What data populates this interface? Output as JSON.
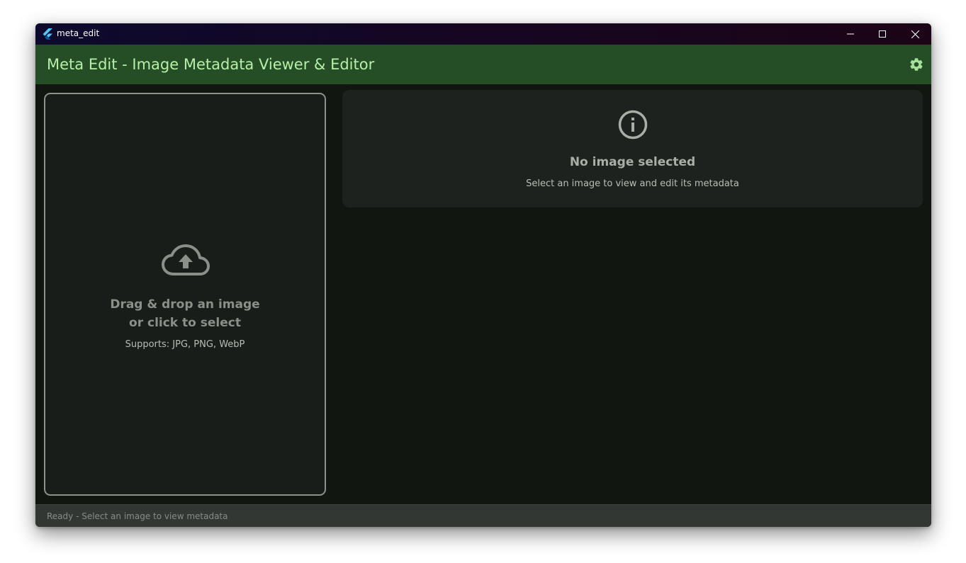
{
  "window": {
    "title": "meta_edit",
    "controls": {
      "minimize_icon": "minimize-icon",
      "maximize_icon": "maximize-icon",
      "close_icon": "close-icon"
    }
  },
  "appbar": {
    "title": "Meta Edit - Image Metadata Viewer & Editor",
    "settings_icon": "gear-icon",
    "background": "#264e26",
    "title_color": "#b6f0a8"
  },
  "dropzone": {
    "icon": "cloud-upload-icon",
    "line1": "Drag & drop an image",
    "line2": "or click to select",
    "supports": "Supports: JPG, PNG, WebP"
  },
  "info_panel": {
    "icon": "info-icon",
    "title": "No image selected",
    "subtitle": "Select an image to view and edit its metadata"
  },
  "statusbar": {
    "text": "Ready - Select an image to view metadata"
  }
}
